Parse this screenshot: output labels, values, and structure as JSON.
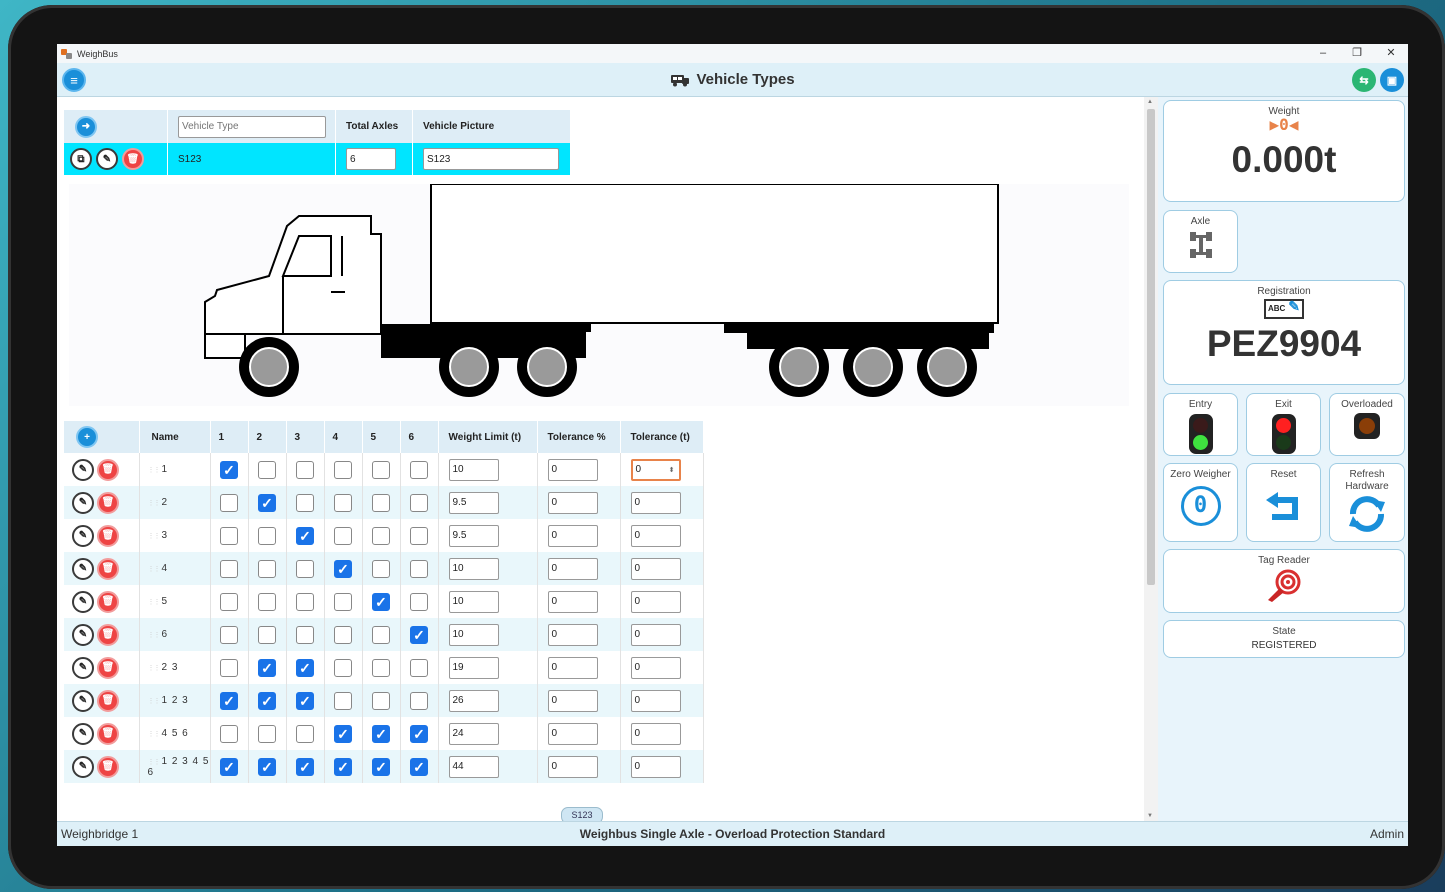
{
  "window": {
    "app_title": "WeighBus",
    "minimize": "–",
    "maximize": "❐",
    "close": "✕"
  },
  "header": {
    "title": "Vehicle Types"
  },
  "vehicle_types": {
    "search_placeholder": "Vehicle Type",
    "col_total_axles": "Total Axles",
    "col_vehicle_picture": "Vehicle Picture",
    "row": {
      "name": "S123",
      "total_axles": "6",
      "picture": "S123"
    }
  },
  "axle_table": {
    "headers": [
      "Name",
      "1",
      "2",
      "3",
      "4",
      "5",
      "6",
      "Weight Limit (t)",
      "Tolerance %",
      "Tolerance (t)"
    ],
    "rows": [
      {
        "name": "1",
        "checks": [
          true,
          false,
          false,
          false,
          false,
          false
        ],
        "weight_limit": "10",
        "tol_pct": "0",
        "tol_t": "0"
      },
      {
        "name": "2",
        "checks": [
          false,
          true,
          false,
          false,
          false,
          false
        ],
        "weight_limit": "9.5",
        "tol_pct": "0",
        "tol_t": "0"
      },
      {
        "name": "3",
        "checks": [
          false,
          false,
          true,
          false,
          false,
          false
        ],
        "weight_limit": "9.5",
        "tol_pct": "0",
        "tol_t": "0"
      },
      {
        "name": "4",
        "checks": [
          false,
          false,
          false,
          true,
          false,
          false
        ],
        "weight_limit": "10",
        "tol_pct": "0",
        "tol_t": "0"
      },
      {
        "name": "5",
        "checks": [
          false,
          false,
          false,
          false,
          true,
          false
        ],
        "weight_limit": "10",
        "tol_pct": "0",
        "tol_t": "0"
      },
      {
        "name": "6",
        "checks": [
          false,
          false,
          false,
          false,
          false,
          true
        ],
        "weight_limit": "10",
        "tol_pct": "0",
        "tol_t": "0"
      },
      {
        "name": "2 3",
        "checks": [
          false,
          true,
          true,
          false,
          false,
          false
        ],
        "weight_limit": "19",
        "tol_pct": "0",
        "tol_t": "0"
      },
      {
        "name": "1 2 3",
        "checks": [
          true,
          true,
          true,
          false,
          false,
          false
        ],
        "weight_limit": "26",
        "tol_pct": "0",
        "tol_t": "0"
      },
      {
        "name": "4 5 6",
        "checks": [
          false,
          false,
          false,
          true,
          true,
          true
        ],
        "weight_limit": "24",
        "tol_pct": "0",
        "tol_t": "0"
      },
      {
        "name": "1 2 3 4 5 6",
        "checks": [
          true,
          true,
          true,
          true,
          true,
          true
        ],
        "weight_limit": "44",
        "tol_pct": "0",
        "tol_t": "0"
      }
    ]
  },
  "page_chip": "S123",
  "side": {
    "weight_label": "Weight",
    "zero_symbol": "▶0◀",
    "weight_value": "0.000t",
    "axle_label": "Axle",
    "registration_label": "Registration",
    "registration_icon_text": "ABC",
    "registration_value": "PEZ9904",
    "entry_label": "Entry",
    "exit_label": "Exit",
    "overloaded_label": "Overloaded",
    "zero_weigher_label": "Zero Weigher",
    "zero_weigher_icon": "0",
    "reset_label": "Reset",
    "refresh_label_1": "Refresh",
    "refresh_label_2": "Hardware",
    "tag_reader_label": "Tag Reader",
    "state_label": "State",
    "state_value": "REGISTERED"
  },
  "status": {
    "left": "Weighbridge 1",
    "center": "Weighbus Single Axle - Overload Protection Standard",
    "right": "Admin"
  },
  "colors": {
    "accent_blue": "#1a8fd9",
    "highlight_row": "#00e5ff",
    "delete_red": "#e44444",
    "zero_orange": "#e8834a",
    "green_button": "#2bb673"
  }
}
